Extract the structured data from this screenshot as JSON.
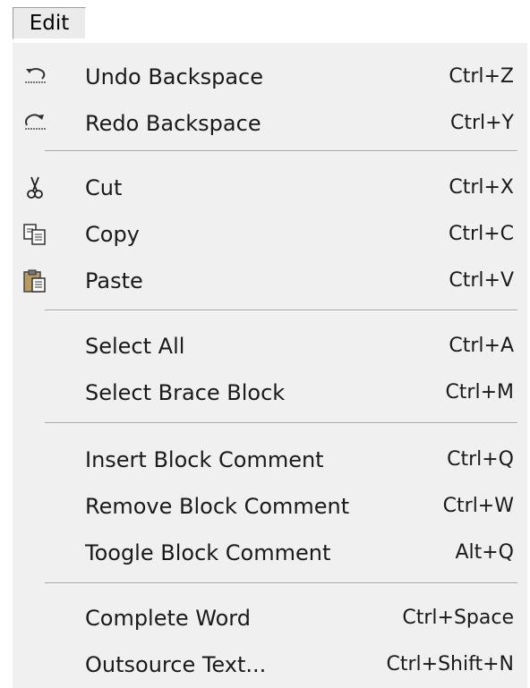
{
  "menubar": {
    "edit_label": "Edit"
  },
  "menu": {
    "groups": [
      {
        "items": [
          {
            "label": "Undo Backspace",
            "shortcut": "Ctrl+Z",
            "icon": "undo-icon"
          },
          {
            "label": "Redo Backspace",
            "shortcut": "Ctrl+Y",
            "icon": "redo-icon"
          }
        ]
      },
      {
        "items": [
          {
            "label": "Cut",
            "shortcut": "Ctrl+X",
            "icon": "scissors-icon"
          },
          {
            "label": "Copy",
            "shortcut": "Ctrl+C",
            "icon": "copy-icon"
          },
          {
            "label": "Paste",
            "shortcut": "Ctrl+V",
            "icon": "clipboard-icon"
          }
        ]
      },
      {
        "items": [
          {
            "label": "Select All",
            "shortcut": "Ctrl+A"
          },
          {
            "label": "Select Brace Block",
            "shortcut": "Ctrl+M"
          }
        ]
      },
      {
        "items": [
          {
            "label": "Insert Block Comment",
            "shortcut": "Ctrl+Q"
          },
          {
            "label": "Remove Block Comment",
            "shortcut": "Ctrl+W"
          },
          {
            "label": "Toogle Block Comment",
            "shortcut": "Alt+Q"
          }
        ]
      },
      {
        "items": [
          {
            "label": "Complete Word",
            "shortcut": "Ctrl+Space"
          },
          {
            "label": "Outsource Text...",
            "shortcut": "Ctrl+Shift+N"
          }
        ]
      }
    ]
  }
}
